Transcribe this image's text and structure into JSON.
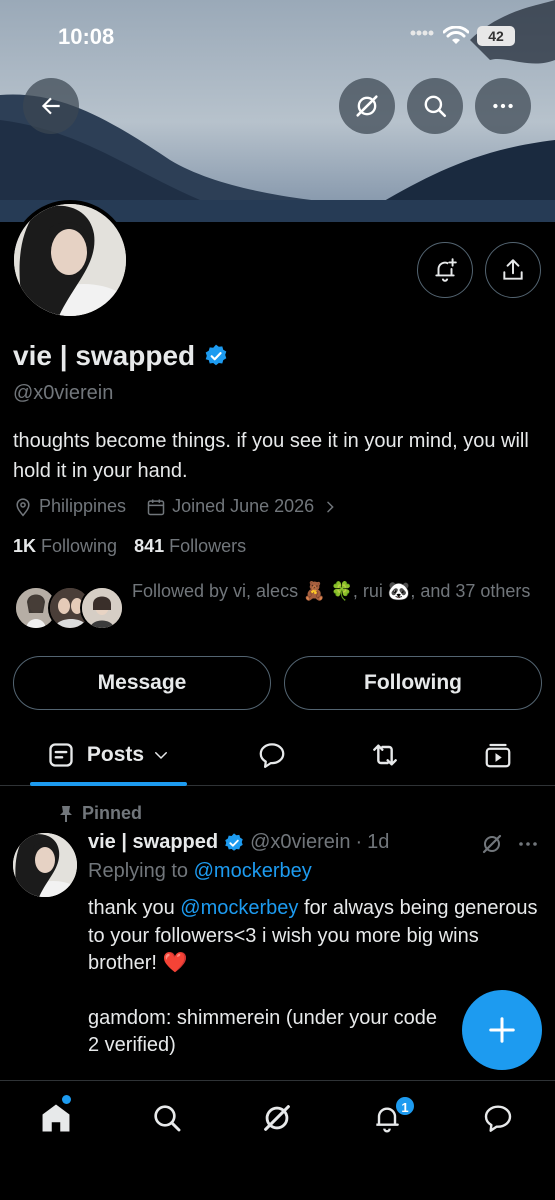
{
  "status_bar": {
    "time": "10:08",
    "battery": "42"
  },
  "header": {
    "back_icon": "arrow-left-icon",
    "grok_icon": "grok-icon",
    "search_icon": "search-icon",
    "more_icon": "more-horizontal-icon"
  },
  "profile": {
    "display_name": "vie | swapped",
    "verified": true,
    "handle": "@x0vierein",
    "bio": "thoughts become things. if you see it in your mind, you will hold it in your hand.",
    "location": "Philippines",
    "joined": "Joined June 2026",
    "following_count": "1K",
    "following_label": "Following",
    "followers_count": "841",
    "followers_label": "Followers",
    "followed_by": "Followed by vi, alecs 🧸 🍀, rui 🐼, and 37 others"
  },
  "actions": {
    "message": "Message",
    "following": "Following"
  },
  "tabs": [
    {
      "label": "Posts",
      "icon": "posts-icon",
      "active": true
    },
    {
      "label": "",
      "icon": "replies-icon"
    },
    {
      "label": "",
      "icon": "reposts-icon"
    },
    {
      "label": "",
      "icon": "media-icon"
    }
  ],
  "pinned_post": {
    "pinned_label": "Pinned",
    "name": "vie | swapped",
    "handle": "@x0vierein",
    "separator": "·",
    "time": "1d",
    "replying_prefix": "Replying to",
    "replying_to": "@mockerbey",
    "text_1": "thank you",
    "mention": "@mockerbey",
    "text_2": "for always being generous to your followers<3 i wish you more big wins brother! ❤️",
    "text_3": "gamdom: shimmerein (under your code",
    "text_4": "2 verified)"
  },
  "bottom_nav": {
    "notifications_badge": "1"
  },
  "colors": {
    "accent": "#1d9bf0",
    "background": "#000000",
    "muted": "#71767b",
    "border": "#2f3336"
  }
}
